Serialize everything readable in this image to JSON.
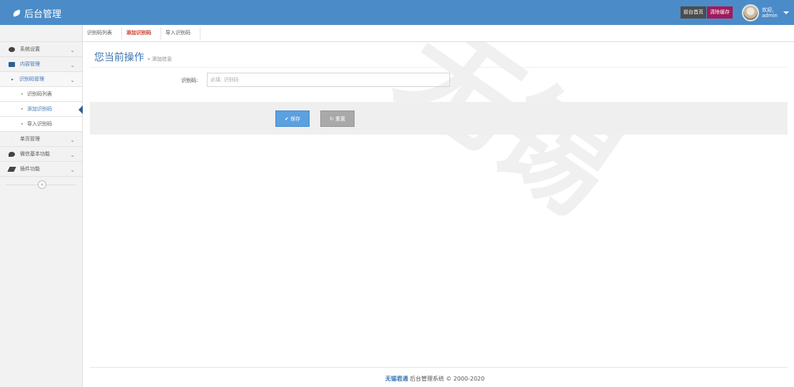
{
  "topbar": {
    "brand": "后台管理",
    "home_btn": "前台首页",
    "cache_btn": "清除缓存",
    "welcome": "欢迎,",
    "username": "admin"
  },
  "sidebar": {
    "system": "系统设置",
    "content": "内容管理",
    "code_mgmt": "识别码管理",
    "code_list": "识别码列表",
    "code_add": "添加识别码",
    "code_import": "导入识别码",
    "single_page": "单页管理",
    "wechat": "微信基本功能",
    "plugins": "插件功能",
    "collapse": "«"
  },
  "tabs": [
    "识别码列表",
    "添加识别码",
    "导入识别码"
  ],
  "breadcrumb": {
    "title": "您当前操作",
    "sub": "» 添加信息"
  },
  "form": {
    "label": "识别码:",
    "placeholder": "必填: 识别码"
  },
  "buttons": {
    "save": "✔ 保存",
    "reset": "↻ 重置"
  },
  "footer": {
    "brand": "无锡君通",
    "text": " 后台管理系统 © 2000-2020"
  },
  "watermark": "无锡"
}
